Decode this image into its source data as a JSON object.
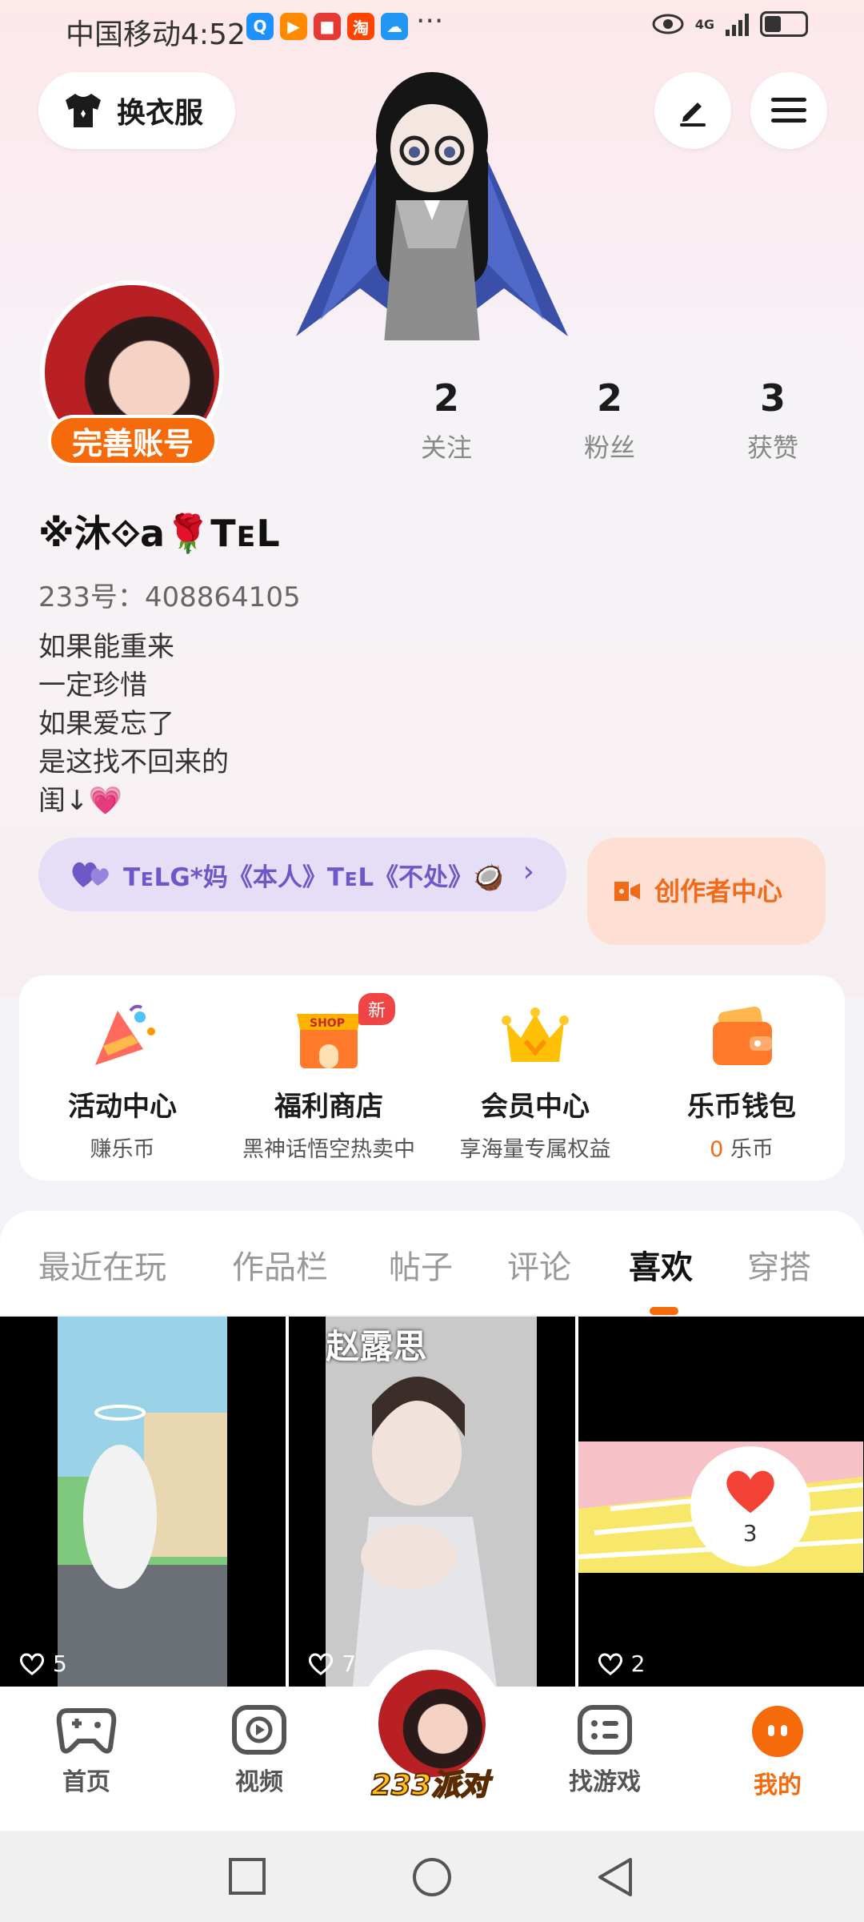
{
  "status_bar": {
    "carrier_time": "中国移动4:52",
    "app_icons": [
      {
        "name": "search-app-icon",
        "glyph": "Q",
        "color": "#1e90ff"
      },
      {
        "name": "video-app-icon",
        "glyph": "▶",
        "color": "#ff8a00"
      },
      {
        "name": "book-app-icon",
        "glyph": "■",
        "color": "#e53935"
      },
      {
        "name": "taobao-app-icon",
        "glyph": "淘",
        "color": "#ff4400"
      },
      {
        "name": "weather-app-icon",
        "glyph": "☁",
        "color": "#2196f3"
      }
    ],
    "more": "···",
    "network": "4G"
  },
  "header": {
    "outfit_label": "换衣服"
  },
  "profile": {
    "complete_label": "完善账号",
    "stats": [
      {
        "num": "2",
        "label": "关注"
      },
      {
        "num": "2",
        "label": "粉丝"
      },
      {
        "num": "3",
        "label": "获赞"
      }
    ],
    "username": "※沐⟐a🌹TᴇL",
    "uid": "233号：408864105",
    "bio": [
      "如果能重来",
      "一定珍惜",
      "如果爱忘了",
      "是这找不回来的",
      "闺↓💗"
    ],
    "guild": "TᴇLG*妈《本人》TᴇL《不处》🥥",
    "creator_label": "创作者中心"
  },
  "services": [
    {
      "title": "活动中心",
      "sub": "赚乐币",
      "icon": "party-horn-icon"
    },
    {
      "title": "福利商店",
      "sub": "黑神话悟空热卖中",
      "icon": "shop-icon",
      "badge": "新",
      "shop_text": "SHOP"
    },
    {
      "title": "会员中心",
      "sub": "享海量专属权益",
      "icon": "crown-icon"
    },
    {
      "title": "乐币钱包",
      "sub_num": "0",
      "sub_unit": "乐币",
      "icon": "wallet-icon"
    }
  ],
  "tabs": [
    "最近在玩",
    "作品栏",
    "帖子",
    "评论",
    "喜欢",
    "穿搭"
  ],
  "active_tab": "喜欢",
  "grid": [
    {
      "likes": "5"
    },
    {
      "likes": "7",
      "caption": "赵露思"
    },
    {
      "likes": "2",
      "overlay_likes": "3"
    }
  ],
  "bottom_nav": [
    {
      "label": "首页",
      "icon": "gamepad-icon"
    },
    {
      "label": "视频",
      "icon": "video-play-icon"
    },
    {
      "label": "233派对",
      "icon": "party-avatar"
    },
    {
      "label": "找游戏",
      "icon": "game-list-icon"
    },
    {
      "label": "我的",
      "icon": "profile-face-icon",
      "active": true
    }
  ],
  "colors": {
    "accent": "#f56a0b",
    "guild_purple": "#6d58c7",
    "guild_bg": "#e4def7",
    "creator_bg": "#fde0d3"
  }
}
